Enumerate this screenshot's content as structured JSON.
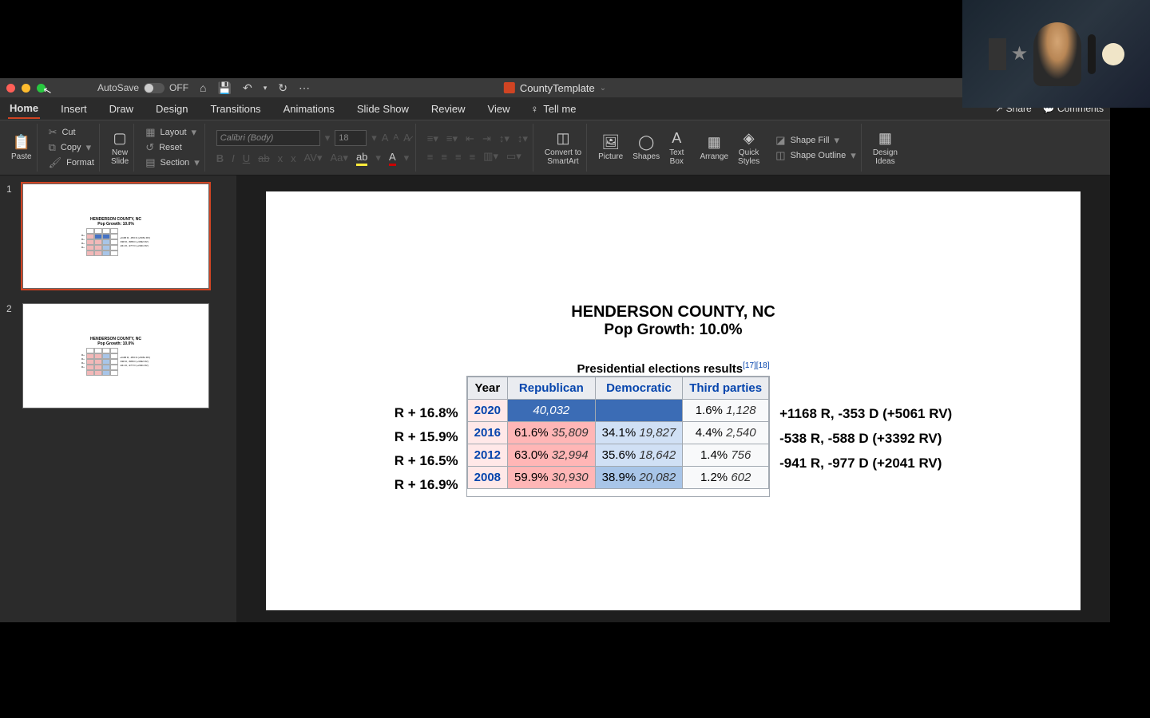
{
  "titlebar": {
    "autosave_label": "AutoSave",
    "autosave_state": "OFF",
    "filename": "CountyTemplate"
  },
  "tabs": {
    "home": "Home",
    "insert": "Insert",
    "draw": "Draw",
    "design": "Design",
    "transitions": "Transitions",
    "animations": "Animations",
    "slideshow": "Slide Show",
    "review": "Review",
    "view": "View",
    "tellme": "Tell me",
    "share": "Share",
    "comments": "Comments"
  },
  "ribbon": {
    "paste": "Paste",
    "cut": "Cut",
    "copy": "Copy",
    "format": "Format",
    "newslide": "New\nSlide",
    "layout": "Layout",
    "reset": "Reset",
    "section": "Section",
    "font_name": "Calibri (Body)",
    "font_size": "18",
    "convert": "Convert to\nSmartArt",
    "picture": "Picture",
    "shapes": "Shapes",
    "textbox": "Text\nBox",
    "arrange": "Arrange",
    "quickstyles": "Quick\nStyles",
    "shapefill": "Shape Fill",
    "shapeoutline": "Shape Outline",
    "designideas": "Design\nIdeas"
  },
  "thumbnails": {
    "n1": "1",
    "n2": "2",
    "mini_title": "HENDERSON COUNTY, NC",
    "mini_sub": "Pop Growth: 10.0%"
  },
  "slide": {
    "title": "HENDERSON COUNTY, NC",
    "subtitle": "Pop Growth: 10.0%",
    "caption": "Presidential elections results",
    "cit1": "[17]",
    "cit2": "[18]",
    "headers": {
      "year": "Year",
      "rep": "Republican",
      "dem": "Democratic",
      "third": "Third parties"
    },
    "left": {
      "r1": "R + 16.8%",
      "r2": "R + 15.9%",
      "r3": "R + 16.5%",
      "r4": "R + 16.9%"
    },
    "rows": {
      "y2020": {
        "year": "2020",
        "rp": "",
        "rv": "40,032",
        "dp": "",
        "dv": "",
        "tp": "1.6%",
        "tv": "1,128"
      },
      "y2016": {
        "year": "2016",
        "rp": "61.6%",
        "rv": "35,809",
        "dp": "34.1%",
        "dv": "19,827",
        "tp": "4.4%",
        "tv": "2,540"
      },
      "y2012": {
        "year": "2012",
        "rp": "63.0%",
        "rv": "32,994",
        "dp": "35.6%",
        "dv": "18,642",
        "tp": "1.4%",
        "tv": "756"
      },
      "y2008": {
        "year": "2008",
        "rp": "59.9%",
        "rv": "30,930",
        "dp": "38.9%",
        "dv": "20,082",
        "tp": "1.2%",
        "tv": "602"
      }
    },
    "right": {
      "r1": "+1168 R, -353 D (+5061 RV)",
      "r2": "-538 R, -588 D (+3392 RV)",
      "r3": "-941 R, -977 D (+2041 RV)"
    }
  }
}
